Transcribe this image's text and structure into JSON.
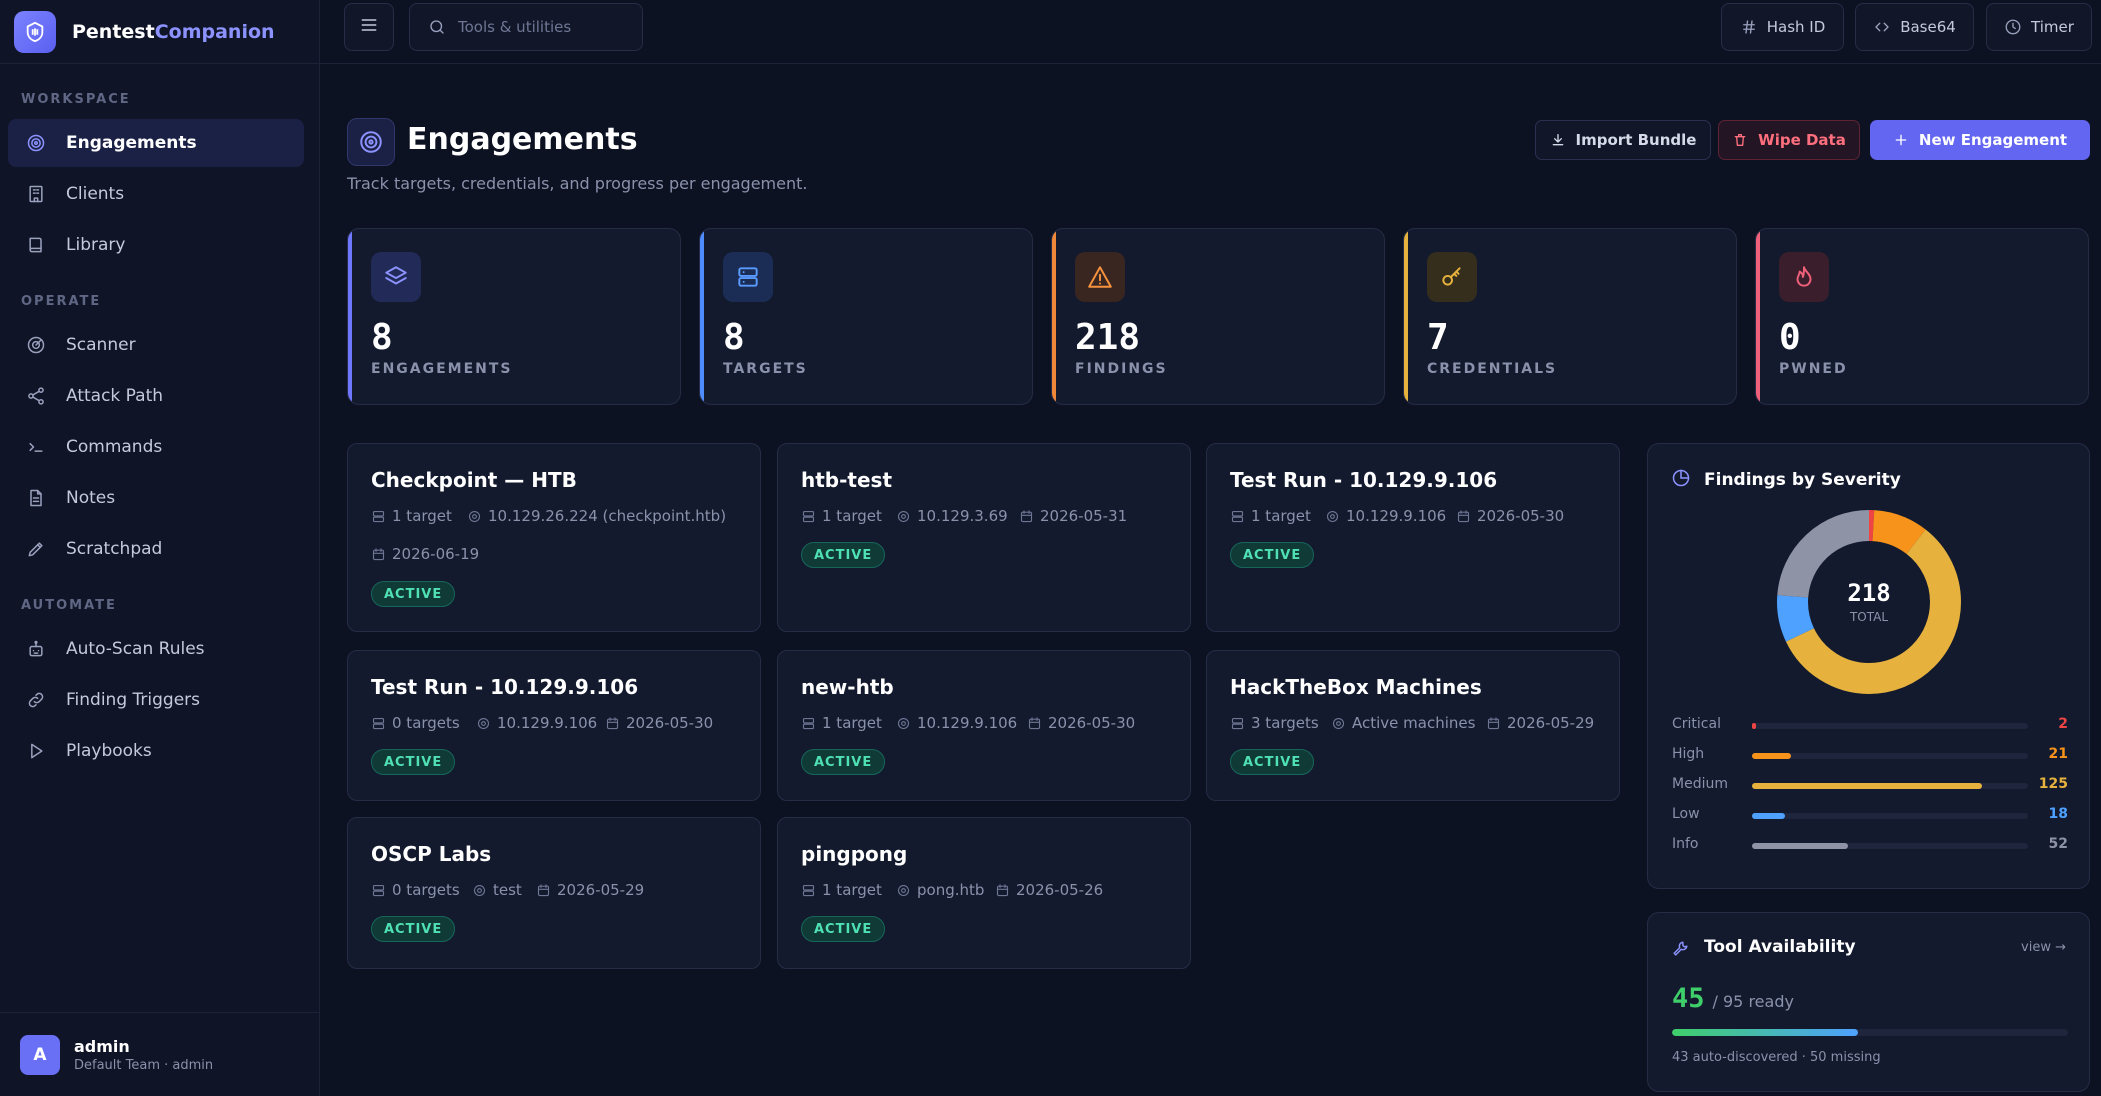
{
  "brand": {
    "name_a": "Pentest",
    "name_b": "Companion"
  },
  "sidebar": {
    "sections": [
      {
        "label": "WORKSPACE"
      },
      {
        "label": "OPERATE"
      },
      {
        "label": "AUTOMATE"
      }
    ],
    "items": [
      {
        "label": "Engagements",
        "icon": "target-icon",
        "active": true
      },
      {
        "label": "Clients",
        "icon": "building-icon"
      },
      {
        "label": "Library",
        "icon": "book-icon"
      },
      {
        "label": "Scanner",
        "icon": "radar-icon"
      },
      {
        "label": "Attack Path",
        "icon": "share-icon"
      },
      {
        "label": "Commands",
        "icon": "terminal-icon"
      },
      {
        "label": "Notes",
        "icon": "document-icon"
      },
      {
        "label": "Scratchpad",
        "icon": "pen-icon"
      },
      {
        "label": "Auto-Scan Rules",
        "icon": "robot-icon"
      },
      {
        "label": "Finding Triggers",
        "icon": "link-icon"
      },
      {
        "label": "Playbooks",
        "icon": "play-icon"
      }
    ],
    "user": {
      "initial": "A",
      "name": "admin",
      "sub": "Default Team · admin"
    }
  },
  "topbar": {
    "search_placeholder": "Tools & utilities",
    "hash_label": "Hash ID",
    "base64_label": "Base64",
    "timer_label": "Timer"
  },
  "page": {
    "title": "Engagements",
    "subtitle": "Track targets, credentials, and progress per engagement.",
    "import_label": "Import Bundle",
    "wipe_label": "Wipe Data",
    "new_label": "New Engagement"
  },
  "stats": [
    {
      "value": "8",
      "label": "ENGAGEMENTS",
      "color": "#6f76ff",
      "icon": "layers-icon"
    },
    {
      "value": "8",
      "label": "TARGETS",
      "color": "#4f8cff",
      "icon": "server-icon"
    },
    {
      "value": "218",
      "label": "FINDINGS",
      "color": "#f0883a",
      "icon": "warning-icon"
    },
    {
      "value": "7",
      "label": "CREDENTIALS",
      "color": "#e6b23d",
      "icon": "key-icon"
    },
    {
      "value": "0",
      "label": "PWNED",
      "color": "#f0607a",
      "icon": "flame-icon"
    }
  ],
  "engagements": [
    {
      "title": "Checkpoint — HTB",
      "targets": "1 target",
      "host": "10.129.26.224 (checkpoint.htb)",
      "date": "2026-06-19",
      "status": "ACTIVE"
    },
    {
      "title": "htb-test",
      "targets": "1 target",
      "host": "10.129.3.69",
      "date": "2026-05-31",
      "status": "ACTIVE"
    },
    {
      "title": "Test Run - 10.129.9.106",
      "targets": "1 target",
      "host": "10.129.9.106",
      "date": "2026-05-30",
      "status": "ACTIVE"
    },
    {
      "title": "Test Run - 10.129.9.106",
      "targets": "0 targets",
      "host": "10.129.9.106",
      "date": "2026-05-30",
      "status": "ACTIVE"
    },
    {
      "title": "new-htb",
      "targets": "1 target",
      "host": "10.129.9.106",
      "date": "2026-05-30",
      "status": "ACTIVE"
    },
    {
      "title": "HackTheBox Machines",
      "targets": "3 targets",
      "host": "Active machines",
      "date": "2026-05-29",
      "status": "ACTIVE"
    },
    {
      "title": "OSCP Labs",
      "targets": "0 targets",
      "host": "test",
      "date": "2026-05-29",
      "status": "ACTIVE"
    },
    {
      "title": "pingpong",
      "targets": "1 target",
      "host": "pong.htb",
      "date": "2026-05-26",
      "status": "ACTIVE"
    }
  ],
  "severity": {
    "title": "Findings by Severity",
    "total": "218",
    "total_label": "TOTAL",
    "rows": [
      {
        "name": "Critical",
        "count": 2,
        "color": "#ef4444"
      },
      {
        "name": "High",
        "count": 21,
        "color": "#f7931a"
      },
      {
        "name": "Medium",
        "count": 125,
        "color": "#e6b23d"
      },
      {
        "name": "Low",
        "count": 18,
        "color": "#4ea1ff"
      },
      {
        "name": "Info",
        "count": 52,
        "color": "#8e94a6"
      }
    ]
  },
  "tools": {
    "title": "Tool Availability",
    "view_label": "view →",
    "ready": "45",
    "total_text": "/ 95 ready",
    "ready_fraction": 0.47,
    "footer": "43 auto-discovered · 50 missing"
  }
}
